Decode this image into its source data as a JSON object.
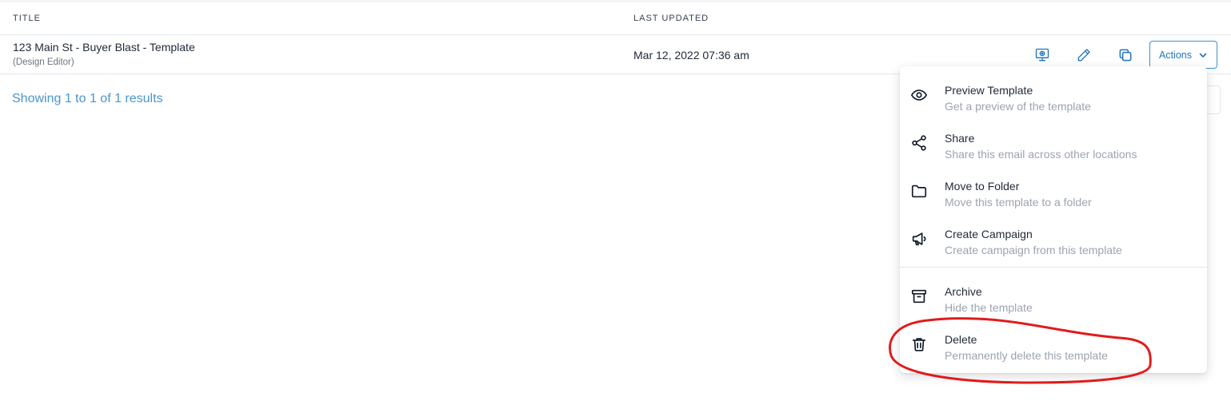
{
  "table": {
    "headers": {
      "title": "TITLE",
      "last_updated": "LAST UPDATED"
    },
    "rows": [
      {
        "title": "123 Main St - Buyer Blast - Template",
        "subtitle": "(Design Editor)",
        "last_updated": "Mar 12, 2022 07:36 am"
      }
    ]
  },
  "row_actions": {
    "icons": [
      "preview-icon",
      "edit-pencil-icon",
      "duplicate-icon"
    ],
    "actions_label": "Actions"
  },
  "results_text": "Showing 1 to 1 of 1 results",
  "dropdown": {
    "items": [
      {
        "label": "Preview Template",
        "description": "Get a preview of the template",
        "icon": "eye-icon"
      },
      {
        "label": "Share",
        "description": "Share this email across other locations",
        "icon": "share-icon"
      },
      {
        "label": "Move to Folder",
        "description": "Move this template to a folder",
        "icon": "folder-icon"
      },
      {
        "label": "Create Campaign",
        "description": "Create campaign from this template",
        "icon": "megaphone-icon"
      },
      {
        "label": "Archive",
        "description": "Hide the template",
        "icon": "archive-icon"
      },
      {
        "label": "Delete",
        "description": "Permanently delete this template",
        "icon": "trash-icon"
      }
    ]
  },
  "colors": {
    "accent": "#1e73be",
    "results_text": "#4a95d0",
    "annotation": "#e01b1b"
  }
}
